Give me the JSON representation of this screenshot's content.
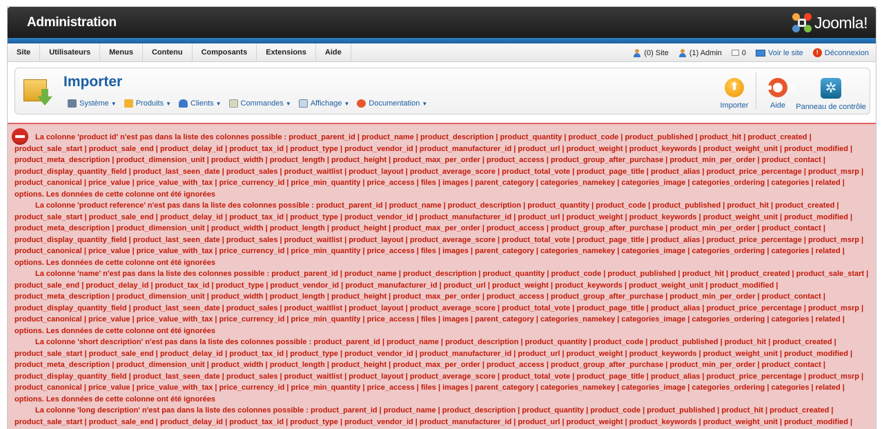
{
  "header": {
    "title": "Administration",
    "logo_text": "Joomla!"
  },
  "menu": {
    "items": [
      "Site",
      "Utilisateurs",
      "Menus",
      "Contenu",
      "Composants",
      "Extensions",
      "Aide"
    ]
  },
  "status": {
    "site_users": "(0) Site",
    "admin_users": "(1) Admin",
    "messages": "0",
    "view_site": "Voir le site",
    "logout": "Déconnexion"
  },
  "toolbar": {
    "title": "Importer",
    "submenu": [
      "Système",
      "Produits",
      "Clients",
      "Commandes",
      "Affichage",
      "Documentation"
    ],
    "import_label": "Importer",
    "help_label": "Aide",
    "panel_label": "Panneau de contrôle"
  },
  "colors": {
    "accent": "#1a5ea3",
    "error_bg": "#efc8c8",
    "error_text": "#c21a08"
  },
  "errors": [
    "La colonne 'product id' n'est pas dans la liste des colonnes possible : product_parent_id | product_name | product_description | product_quantity | product_code | product_published | product_hit | product_created | product_sale_start | product_sale_end | product_delay_id | product_tax_id | product_type | product_vendor_id | product_manufacturer_id | product_url | product_weight | product_keywords | product_weight_unit | product_modified | product_meta_description | product_dimension_unit | product_width | product_length | product_height | product_max_per_order | product_access | product_group_after_purchase | product_min_per_order | product_contact | product_display_quantity_field | product_last_seen_date | product_sales | product_waitlist | product_layout | product_average_score | product_total_vote | product_page_title | product_alias | product_price_percentage | product_msrp | product_canonical | price_value | price_value_with_tax | price_currency_id | price_min_quantity | price_access | files | images | parent_category | categories_namekey | categories_image | categories_ordering | categories | related | options. Les données de cette colonne ont été ignorées",
    "La colonne 'product reference' n'est pas dans la liste des colonnes possible : product_parent_id | product_name | product_description | product_quantity | product_code | product_published | product_hit | product_created | product_sale_start | product_sale_end | product_delay_id | product_tax_id | product_type | product_vendor_id | product_manufacturer_id | product_url | product_weight | product_keywords | product_weight_unit | product_modified | product_meta_description | product_dimension_unit | product_width | product_length | product_height | product_max_per_order | product_access | product_group_after_purchase | product_min_per_order | product_contact | product_display_quantity_field | product_last_seen_date | product_sales | product_waitlist | product_layout | product_average_score | product_total_vote | product_page_title | product_alias | product_price_percentage | product_msrp | product_canonical | price_value | price_value_with_tax | price_currency_id | price_min_quantity | price_access | files | images | parent_category | categories_namekey | categories_image | categories_ordering | categories | related | options. Les données de cette colonne ont été ignorées",
    "La colonne 'name' n'est pas dans la liste des colonnes possible : product_parent_id | product_name | product_description | product_quantity | product_code | product_published | product_hit | product_created | product_sale_start | product_sale_end | product_delay_id | product_tax_id | product_type | product_vendor_id | product_manufacturer_id | product_url | product_weight | product_keywords | product_weight_unit | product_modified | product_meta_description | product_dimension_unit | product_width | product_length | product_height | product_max_per_order | product_access | product_group_after_purchase | product_min_per_order | product_contact | product_display_quantity_field | product_last_seen_date | product_sales | product_waitlist | product_layout | product_average_score | product_total_vote | product_page_title | product_alias | product_price_percentage | product_msrp | product_canonical | price_value | price_value_with_tax | price_currency_id | price_min_quantity | price_access | files | images | parent_category | categories_namekey | categories_image | categories_ordering | categories | related | options. Les données de cette colonne ont été ignorées",
    "La colonne 'short description' n'est pas dans la liste des colonnes possible : product_parent_id | product_name | product_description | product_quantity | product_code | product_published | product_hit | product_created | product_sale_start | product_sale_end | product_delay_id | product_tax_id | product_type | product_vendor_id | product_manufacturer_id | product_url | product_weight | product_keywords | product_weight_unit | product_modified | product_meta_description | product_dimension_unit | product_width | product_length | product_height | product_max_per_order | product_access | product_group_after_purchase | product_min_per_order | product_contact | product_display_quantity_field | product_last_seen_date | product_sales | product_waitlist | product_layout | product_average_score | product_total_vote | product_page_title | product_alias | product_price_percentage | product_msrp | product_canonical | price_value | price_value_with_tax | price_currency_id | price_min_quantity | price_access | files | images | parent_category | categories_namekey | categories_image | categories_ordering | categories | related | options. Les données de cette colonne ont été ignorées",
    "La colonne 'long description' n'est pas dans la liste des colonnes possible : product_parent_id | product_name | product_description | product_quantity | product_code | product_published | product_hit | product_created | product_sale_start | product_sale_end | product_delay_id | product_tax_id | product_type | product_vendor_id | product_manufacturer_id | product_url | product_weight | product_keywords | product_weight_unit | product_modified |"
  ]
}
